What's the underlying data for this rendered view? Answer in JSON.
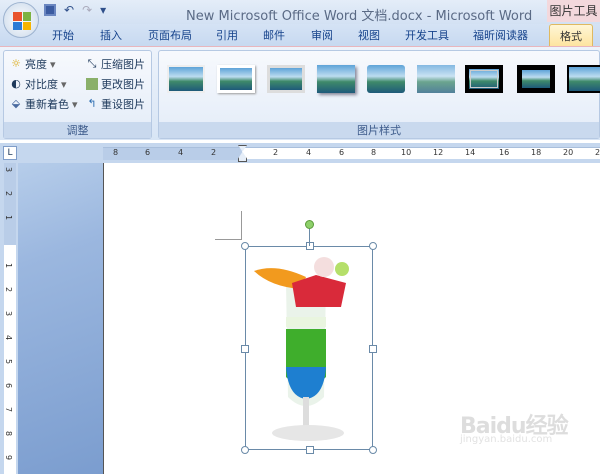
{
  "window": {
    "title": "New Microsoft Office Word 文档.docx - Microsoft Word",
    "contextual_tab_group": "图片工具"
  },
  "quick_access": {
    "save": "save-icon",
    "undo": "↶",
    "redo": "↷",
    "customize": "▾"
  },
  "tabs": [
    {
      "label": "开始"
    },
    {
      "label": "插入"
    },
    {
      "label": "页面布局"
    },
    {
      "label": "引用"
    },
    {
      "label": "邮件"
    },
    {
      "label": "审阅"
    },
    {
      "label": "视图"
    },
    {
      "label": "开发工具"
    },
    {
      "label": "福昕阅读器"
    },
    {
      "label": "格式",
      "active": true
    }
  ],
  "ribbon": {
    "adjust": {
      "label": "调整",
      "items": [
        {
          "label": "亮度",
          "dropdown": "▾"
        },
        {
          "label": "对比度",
          "dropdown": "▾"
        },
        {
          "label": "重新着色",
          "dropdown": "▾"
        },
        {
          "label": "压缩图片"
        },
        {
          "label": "更改图片"
        },
        {
          "label": "重设图片"
        }
      ]
    },
    "picture_styles": {
      "label": "图片样式",
      "count": 9
    }
  },
  "ruler": {
    "corner": "L",
    "h_left": [
      "8",
      "6",
      "4",
      "2"
    ],
    "h_right": [
      "2",
      "4",
      "6",
      "8",
      "10",
      "12",
      "14",
      "16",
      "18",
      "20",
      "2"
    ],
    "v_top": [
      "3",
      "2",
      "1"
    ],
    "v_main": [
      "1",
      "2",
      "3",
      "4",
      "5",
      "6",
      "7",
      "8",
      "9"
    ]
  },
  "watermark": {
    "brand": "Baidu经验",
    "url": "jingyan.baidu.com"
  }
}
